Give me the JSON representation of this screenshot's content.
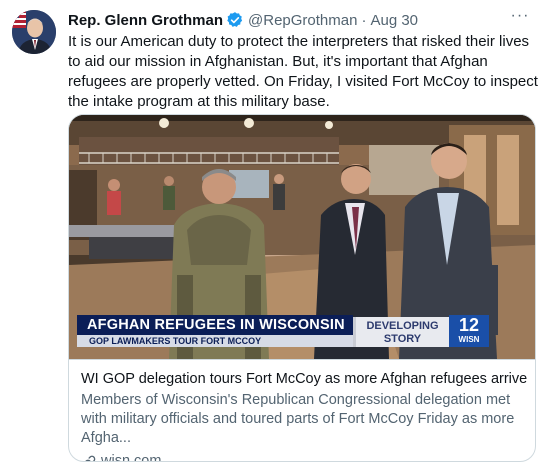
{
  "author": {
    "display_name": "Rep. Glenn Grothman",
    "handle": "@RepGrothman",
    "separator": "·",
    "date": "Aug 30"
  },
  "menu": {
    "more_glyph": "···"
  },
  "tweet": {
    "text": "It is our American duty to protect the interpreters that risked their lives to aid our mission in Afghanistan. But, it's important that Afghan refugees are properly vetted. On Friday, I visited Fort McCoy to inspect the intake program at this military base."
  },
  "card": {
    "image": {
      "lower_third_headline": "AFGHAN REFUGEES IN WISCONSIN",
      "lower_third_sub": "GOP LAWMAKERS TOUR FORT MCCOY",
      "developing_line1": "DEVELOPING",
      "developing_line2": "STORY",
      "station_channel": "12",
      "station_call": "WISN"
    },
    "title": "WI GOP delegation tours Fort McCoy as more Afghan refugees arrive",
    "description": "Members of Wisconsin's Republican Congressional delegation met with military officials and toured parts of Fort McCoy Friday as more Afgha...",
    "domain": "wisn.com"
  },
  "colors": {
    "verified_blue": "#1d9bf0",
    "secondary_text": "#536471",
    "lower_third_navy": "#0b1e57",
    "wisn_blue": "#1a4fa8"
  },
  "icons": {
    "verified": "verified-badge-icon",
    "more": "more-options-icon",
    "link": "link-icon"
  }
}
